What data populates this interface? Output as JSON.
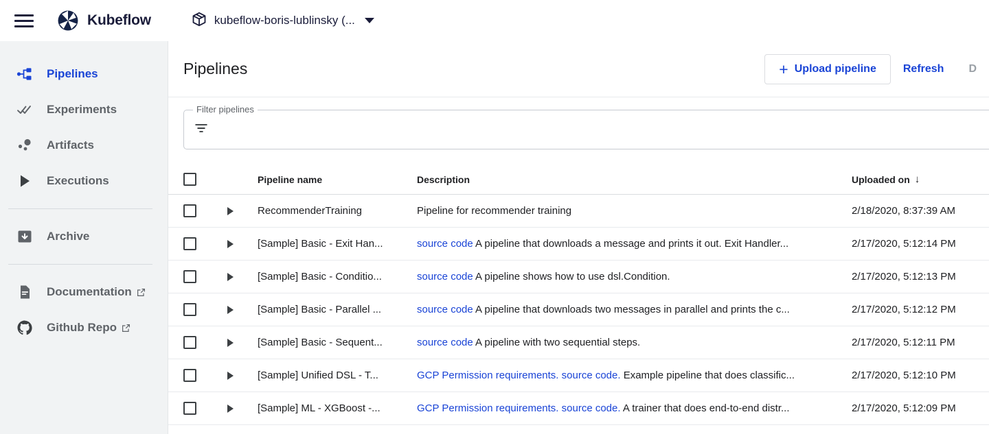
{
  "topbar": {
    "menu_icon": "hamburger-icon",
    "logo_icon": "kubeflow-logo-icon",
    "brand_name": "Kubeflow",
    "namespace_icon": "package-icon",
    "namespace_label": "kubeflow-boris-lublinsky (...",
    "namespace_caret_icon": "chevron-down-icon"
  },
  "sidebar": {
    "items": [
      {
        "label": "Pipelines",
        "icon": "pipelines-icon",
        "active": true,
        "external": false
      },
      {
        "label": "Experiments",
        "icon": "experiments-icon",
        "active": false,
        "external": false
      },
      {
        "label": "Artifacts",
        "icon": "artifacts-icon",
        "active": false,
        "external": false
      },
      {
        "label": "Executions",
        "icon": "executions-icon",
        "active": false,
        "external": false
      },
      {
        "label": "Archive",
        "icon": "archive-icon",
        "active": false,
        "external": false
      },
      {
        "label": "Documentation",
        "icon": "document-icon",
        "active": false,
        "external": true
      },
      {
        "label": "Github Repo",
        "icon": "github-icon",
        "active": false,
        "external": true
      }
    ]
  },
  "main": {
    "page_title": "Pipelines",
    "upload_button": "Upload pipeline",
    "upload_plus_icon": "plus-icon",
    "refresh_button": "Refresh",
    "delete_button": "D",
    "filter": {
      "legend": "Filter pipelines",
      "icon": "filter-icon",
      "value": "",
      "placeholder": ""
    },
    "table": {
      "columns": {
        "select_all_icon": "checkbox-icon",
        "name": "Pipeline name",
        "description": "Description",
        "uploaded_on": "Uploaded on",
        "sort_icon": "arrow-down-icon"
      },
      "rows": [
        {
          "checkbox_icon": "checkbox-icon",
          "expand_icon": "expand-triangle-icon",
          "name": "RecommenderTraining",
          "desc_links": [],
          "desc_text": "Pipeline for recommender training",
          "uploaded_on": "2/18/2020, 8:37:39 AM"
        },
        {
          "checkbox_icon": "checkbox-icon",
          "expand_icon": "expand-triangle-icon",
          "name": "[Sample] Basic - Exit Han...",
          "desc_links": [
            "source code"
          ],
          "desc_text": " A pipeline that downloads a message and prints it out. Exit Handler...",
          "uploaded_on": "2/17/2020, 5:12:14 PM"
        },
        {
          "checkbox_icon": "checkbox-icon",
          "expand_icon": "expand-triangle-icon",
          "name": "[Sample] Basic - Conditio...",
          "desc_links": [
            "source code"
          ],
          "desc_text": " A pipeline shows how to use dsl.Condition.",
          "uploaded_on": "2/17/2020, 5:12:13 PM"
        },
        {
          "checkbox_icon": "checkbox-icon",
          "expand_icon": "expand-triangle-icon",
          "name": "[Sample] Basic - Parallel ...",
          "desc_links": [
            "source code"
          ],
          "desc_text": " A pipeline that downloads two messages in parallel and prints the c...",
          "uploaded_on": "2/17/2020, 5:12:12 PM"
        },
        {
          "checkbox_icon": "checkbox-icon",
          "expand_icon": "expand-triangle-icon",
          "name": "[Sample] Basic - Sequent...",
          "desc_links": [
            "source code"
          ],
          "desc_text": " A pipeline with two sequential steps.",
          "uploaded_on": "2/17/2020, 5:12:11 PM"
        },
        {
          "checkbox_icon": "checkbox-icon",
          "expand_icon": "expand-triangle-icon",
          "name": "[Sample] Unified DSL - T...",
          "desc_links": [
            "GCP Permission requirements.",
            "source code."
          ],
          "desc_text": " Example pipeline that does classific...",
          "uploaded_on": "2/17/2020, 5:12:10 PM"
        },
        {
          "checkbox_icon": "checkbox-icon",
          "expand_icon": "expand-triangle-icon",
          "name": "[Sample] ML - XGBoost -...",
          "desc_links": [
            "GCP Permission requirements.",
            "source code."
          ],
          "desc_text": " A trainer that does end-to-end distr...",
          "uploaded_on": "2/17/2020, 5:12:09 PM"
        }
      ]
    }
  },
  "colors": {
    "accent_blue": "#1a44d6",
    "brand_navy": "#1a1c3a",
    "sidebar_bg": "#f1f3f4",
    "text_primary": "#202124",
    "text_secondary": "#5f6368",
    "disabled": "#9aa0a6"
  }
}
